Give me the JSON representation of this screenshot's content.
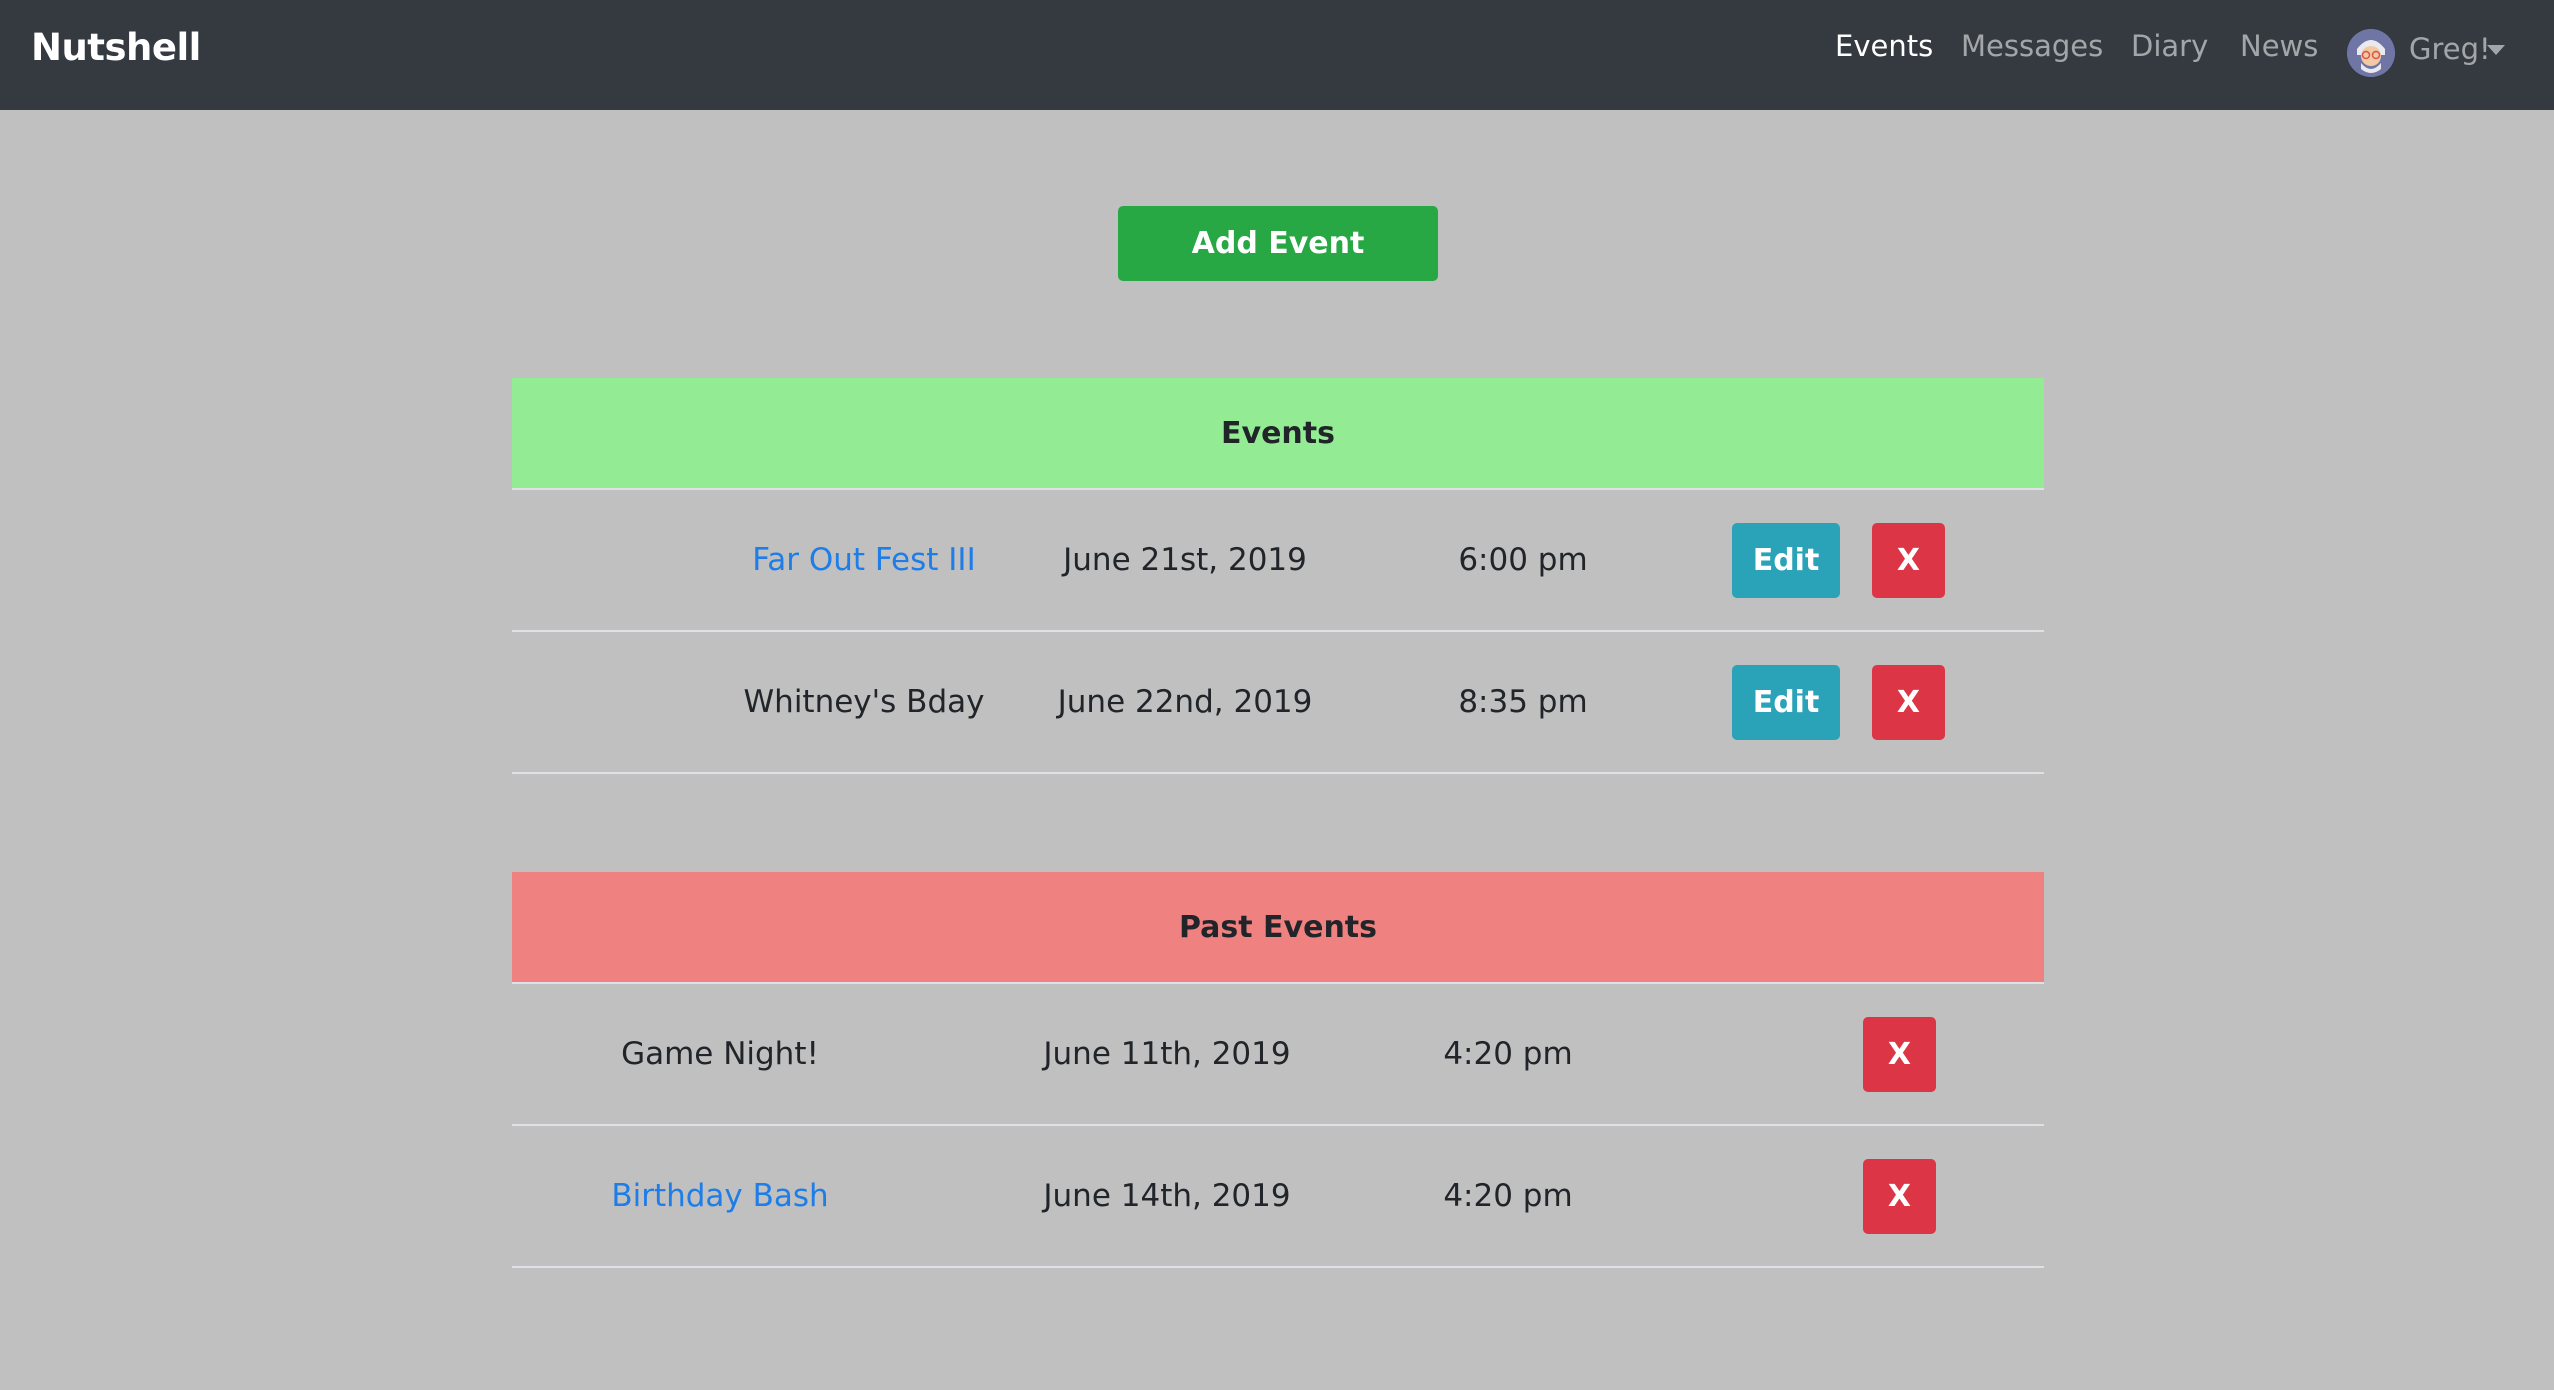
{
  "navbar": {
    "brand": "Nutshell",
    "links": [
      {
        "label": "Events",
        "active": true
      },
      {
        "label": "Messages",
        "active": false
      },
      {
        "label": "Diary",
        "active": false
      },
      {
        "label": "News",
        "active": false
      }
    ],
    "user": {
      "name": "Greg!",
      "avatar_icon": "user-avatar"
    }
  },
  "add_event": {
    "label": "Add Event",
    "color": "#28a745"
  },
  "upcoming": {
    "title": "Events",
    "header_color": "#93eb93",
    "rows": [
      {
        "name": "Far Out Fest III",
        "is_link": true,
        "date": "June 21st, 2019",
        "time": "6:00 pm",
        "edit_label": "Edit",
        "delete_label": "X"
      },
      {
        "name": "Whitney's Bday",
        "is_link": false,
        "date": "June 22nd, 2019",
        "time": "8:35 pm",
        "edit_label": "Edit",
        "delete_label": "X"
      }
    ]
  },
  "past": {
    "title": "Past Events",
    "header_color": "#ef8181",
    "rows": [
      {
        "name": "Game Night!",
        "is_link": false,
        "date": "June 11th, 2019",
        "time": "4:20 pm",
        "delete_label": "X"
      },
      {
        "name": "Birthday Bash",
        "is_link": true,
        "date": "June 14th, 2019",
        "time": "4:20 pm",
        "delete_label": "X"
      }
    ]
  },
  "colors": {
    "link": "#1e7de6",
    "edit_button": "#2aa3b8",
    "delete_button": "#dc3545",
    "navbar": "#343a40",
    "background": "#c0c0c0"
  }
}
